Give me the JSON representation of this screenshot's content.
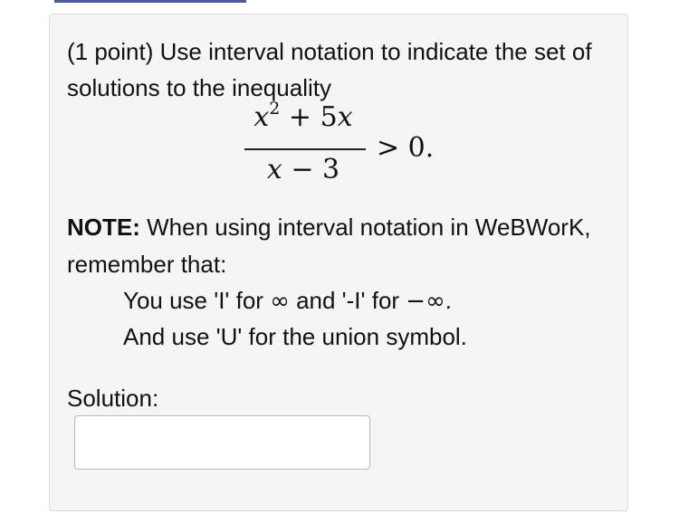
{
  "problem": {
    "intro_text": "(1 point) Use interval notation to indicate the set of solutions to the inequality",
    "inequality": {
      "numerator_var": "x",
      "numerator_exp": "2",
      "numerator_rest": " + 5",
      "numerator_var2": "x",
      "denominator_var": "x",
      "denominator_rest": " − 3",
      "relation": "> 0."
    },
    "note": {
      "label": "NOTE:",
      "text": " When using interval notation in WeBWorK, remember that:",
      "hint1_pre": "You use 'I' for ",
      "hint1_mid": " and '-I' for ",
      "hint1_post": ".",
      "hint2": "And use 'U' for the union symbol.",
      "infinity_symbol": "∞",
      "neg_infinity_symbol": "−∞"
    },
    "solution_label": "Solution:",
    "answer": {
      "value": "",
      "placeholder": ""
    }
  },
  "colors": {
    "top_bar": "#4a5a9a",
    "panel_background": "#f5f5f5",
    "panel_border": "#dcdcdc"
  }
}
